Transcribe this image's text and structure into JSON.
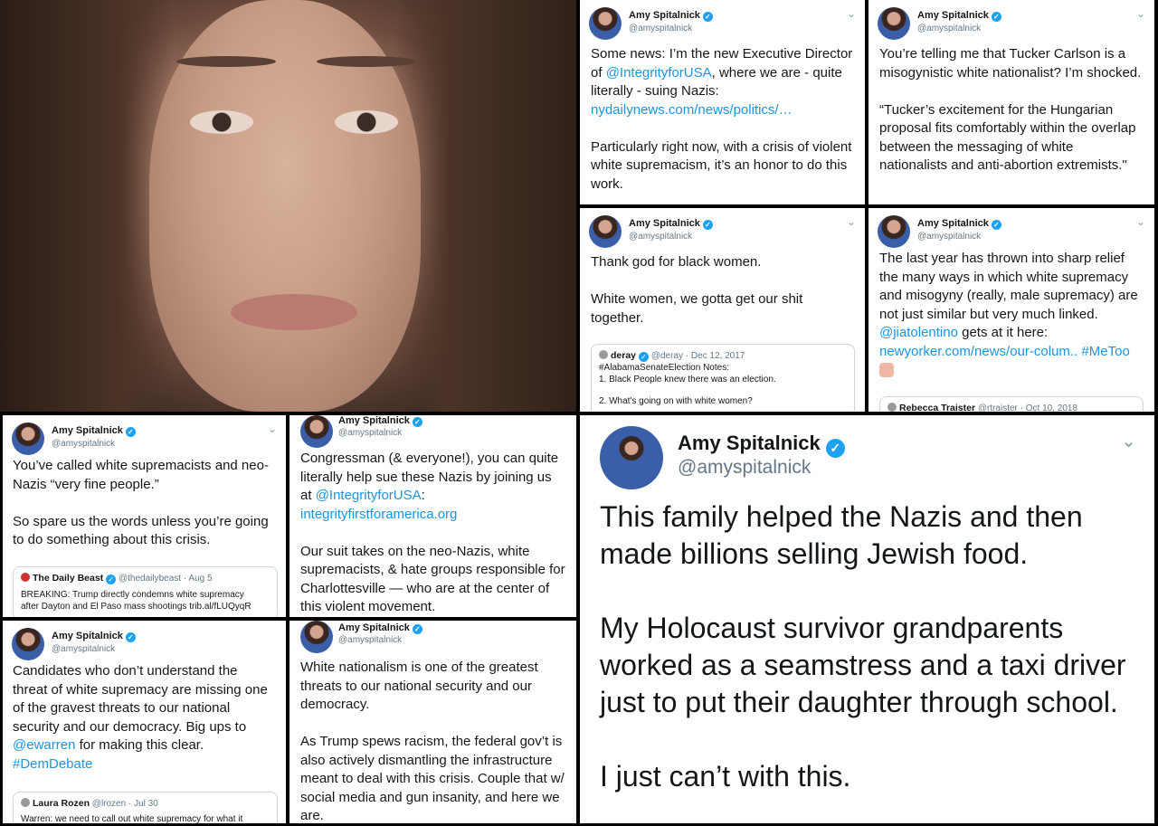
{
  "author": {
    "name": "Amy Spitalnick",
    "handle": "@amyspitalnick",
    "verified_icon": "verified-badge-icon"
  },
  "tweets": {
    "t1": {
      "paras": [
        {
          "pre": "Some news: I’m the new Executive Director of ",
          "mention": "@IntegrityforUSA",
          "post": ", where we are - quite literally - suing Nazis: ",
          "link": "nydailynews.com/news/politics/…"
        },
        {
          "text": "Particularly right now, with a crisis of violent white supremacism, it’s an honor to do this work."
        }
      ]
    },
    "t2": {
      "p1": "You’re telling me that Tucker Carlson is a misogynistic white nationalist? I’m shocked.",
      "p2": "“Tucker’s excitement for the Hungarian proposal fits comfortably within the overlap between the messaging of white nationalists and anti-abortion extremists.\""
    },
    "t3": {
      "p1": "Thank god for black women.",
      "p2": "White women, we gotta get our shit together.",
      "quote": {
        "name": "deray",
        "handle": "@deray",
        "date": "· Dec 12, 2017",
        "line1": "#AlabamaSenateElection Notes:",
        "line2": "1. Black People knew there was an election.",
        "line3": "2. What's going on with white women?"
      }
    },
    "t4": {
      "text": "The last year has thrown into sharp relief the many ways in which white supremacy and misogyny (really, male supremacy) are not just similar but very much linked. ",
      "mention": "@jiatolentino",
      "mid": " gets at it here: ",
      "link": "newyorker.com/news/our-colum..",
      "hashtag": " #MeToo",
      "quote": {
        "name": "Rebecca Traister",
        "handle": "@rtraister",
        "date": "· Oct 10, 2018"
      }
    },
    "t5": {
      "p1": "You’ve called white supremacists and neo-Nazis “very fine people.”",
      "p2": "So spare us the words unless you’re going to do something about this crisis.",
      "quote": {
        "name": "The Daily Beast",
        "handle": "@thedailybeast",
        "date": "· Aug 5",
        "line1": "BREAKING: Trump directly condemns white supremacy",
        "line2": "after Dayton and El Paso mass shootings trib.al/fLUQyqR"
      }
    },
    "t6": {
      "p1_pre": "Congressman (& everyone!), you can quite literally help sue these Nazis by joining us at ",
      "mention": "@IntegrityforUSA",
      "colon": ":",
      "link": "integrityfirstforamerica.org",
      "p2": "Our suit takes on the neo-Nazis, white supremacists, & hate groups responsible for Charlottesville — who are at the center of this violent movement."
    },
    "t7": {
      "text": "Candidates who don’t understand the threat of white supremacy are missing one of the gravest threats to our national security and our democracy. Big ups to ",
      "mention": "@ewarren",
      "post": " for making this clear.",
      "hashtag": "#DemDebate",
      "quote": {
        "name": "Laura Rozen",
        "handle": "@lrozen",
        "date": "· Jul 30",
        "line1": "Warren: we need to call out white supremacy for what it"
      }
    },
    "t8": {
      "p1": "White nationalism is one of the greatest threats to our national security and our democracy.",
      "p2": "As Trump spews racism, the federal gov’t is also actively dismantling the infrastructure meant to deal with this crisis. Couple that w/ social media and gun insanity, and here we are."
    },
    "t9": {
      "p1": "This family helped the Nazis and then made billions selling Jewish food.",
      "p2": "My Holocaust survivor grandparents worked as a seamstress and a taxi driver just to put their daughter through school.",
      "p3": "I just can’t with this."
    }
  },
  "icons": {
    "chevron": "chevron-down-icon",
    "verified": "✓"
  }
}
